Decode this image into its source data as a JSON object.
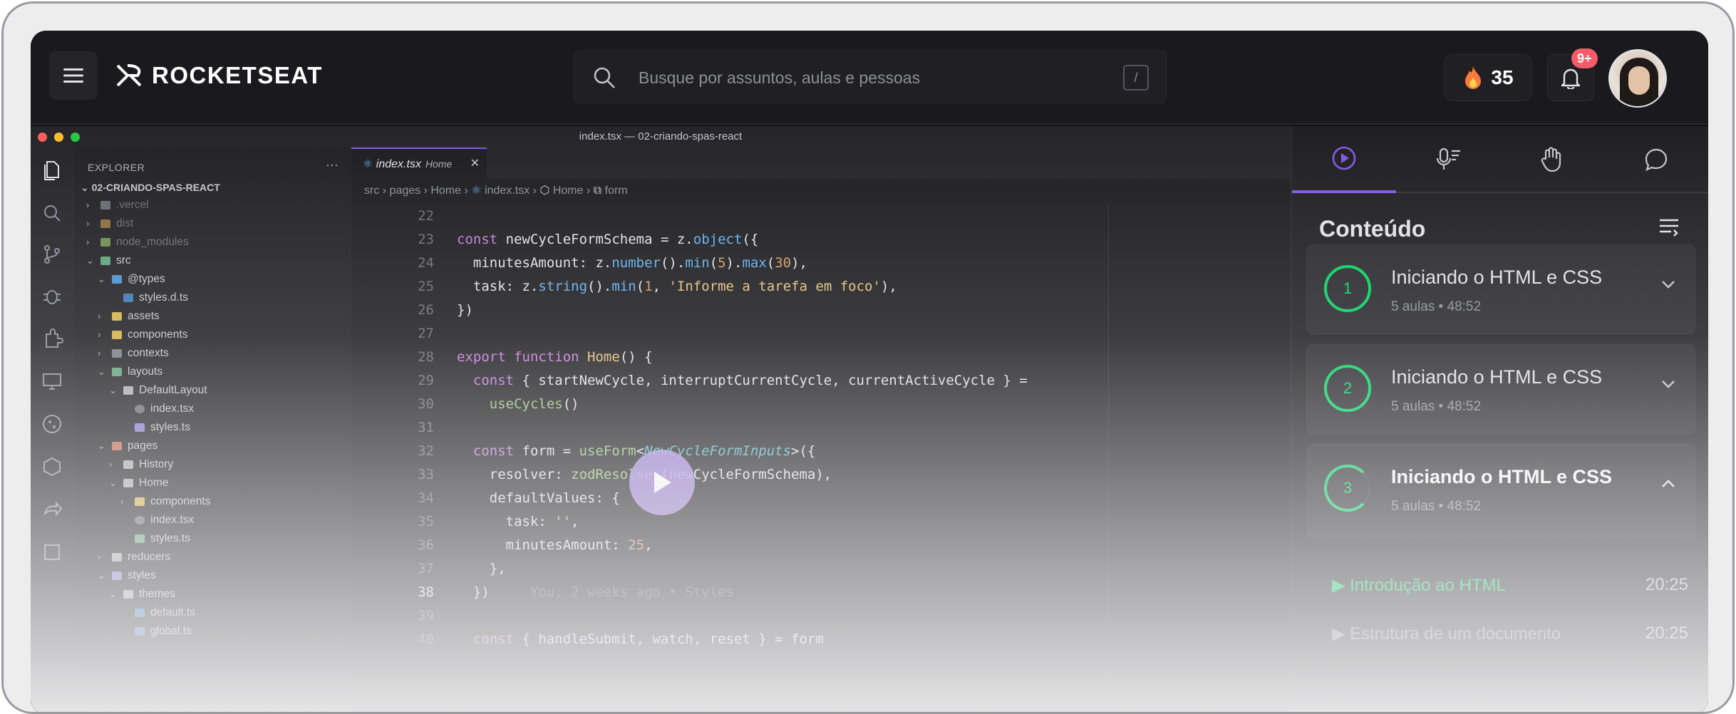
{
  "header": {
    "logo_text": "ROCKETSEAT",
    "search_placeholder": "Busque por assuntos, aulas e pessoas",
    "search_shortcut": "/",
    "streak_count": "35",
    "notifications_badge": "9+"
  },
  "editor": {
    "window_title": "index.tsx — 02-criando-spas-react",
    "explorer_title": "EXPLORER",
    "project_name": "02-CRIANDO-SPAS-REACT",
    "tree": [
      {
        "label": ".vercel",
        "dim": true
      },
      {
        "label": "dist",
        "dim": true
      },
      {
        "label": "node_modules",
        "dim": true
      },
      {
        "label": "src",
        "dim": false
      },
      {
        "label": "@types",
        "dim": false
      },
      {
        "label": "styles.d.ts",
        "dim": false
      },
      {
        "label": "assets",
        "dim": false
      },
      {
        "label": "components",
        "dim": false
      },
      {
        "label": "contexts",
        "dim": false
      },
      {
        "label": "layouts",
        "dim": false
      },
      {
        "label": "DefaultLayout",
        "dim": false
      },
      {
        "label": "index.tsx",
        "dim": false
      },
      {
        "label": "styles.ts",
        "dim": false
      },
      {
        "label": "pages",
        "dim": false
      },
      {
        "label": "History",
        "dim": false
      },
      {
        "label": "Home",
        "dim": false
      },
      {
        "label": "components",
        "dim": false
      },
      {
        "label": "index.tsx",
        "dim": false
      },
      {
        "label": "styles.ts",
        "dim": false
      },
      {
        "label": "reducers",
        "dim": false
      },
      {
        "label": "styles",
        "dim": false
      },
      {
        "label": "themes",
        "dim": false
      },
      {
        "label": "default.ts",
        "dim": false
      },
      {
        "label": "global.ts",
        "dim": false
      }
    ],
    "tab_name": "index.tsx",
    "tab_hint": "Home",
    "breadcrumb": [
      "src",
      "pages",
      "Home",
      "index.tsx",
      "Home",
      "form"
    ],
    "line_numbers": [
      "22",
      "23",
      "24",
      "25",
      "26",
      "27",
      "28",
      "29",
      "30",
      "31",
      "32",
      "33",
      "34",
      "35",
      "36",
      "37",
      "38",
      "39",
      "40"
    ],
    "inline_hint": "You, 2 weeks ago • Styles"
  },
  "panel": {
    "heading": "Conteúdo",
    "modules": [
      {
        "number": "1",
        "title": "Iniciando o HTML e CSS",
        "lessons": "5 aulas",
        "duration": "48:52"
      },
      {
        "number": "2",
        "title": "Iniciando o HTML e CSS",
        "lessons": "5 aulas",
        "duration": "48:52"
      },
      {
        "number": "3",
        "title": "Iniciando o HTML e CSS",
        "lessons": "5 aulas",
        "duration": "48:52"
      }
    ],
    "lessons": [
      {
        "title": "Introdução ao HTML",
        "duration": "20:25"
      },
      {
        "title": "Estrutura de um documento",
        "duration": "20:25"
      }
    ]
  },
  "colors": {
    "accent": "#8257e5",
    "success": "#04d361",
    "alert": "#f75a68"
  }
}
